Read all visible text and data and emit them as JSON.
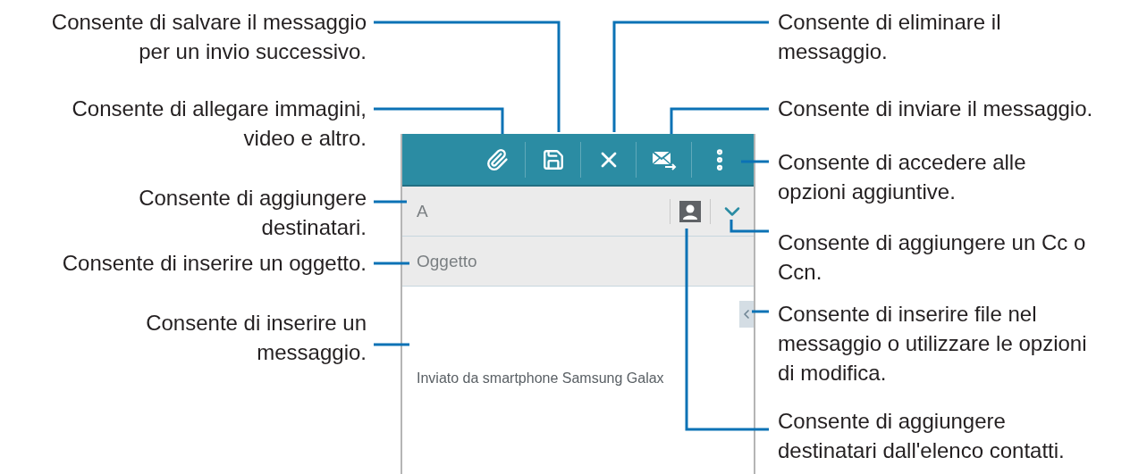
{
  "callouts_left": [
    {
      "lines": [
        "Consente di salvare il messaggio",
        "per un invio successivo."
      ]
    },
    {
      "lines": [
        "Consente di allegare immagini,",
        "video e altro."
      ]
    },
    {
      "lines": [
        "Consente di aggiungere",
        "destinatari."
      ]
    },
    {
      "lines": [
        "Consente di inserire un oggetto."
      ]
    },
    {
      "lines": [
        "Consente di inserire un",
        "messaggio."
      ]
    }
  ],
  "callouts_right": [
    {
      "lines": [
        "Consente di eliminare il",
        "messaggio."
      ]
    },
    {
      "lines": [
        "Consente di inviare il messaggio."
      ]
    },
    {
      "lines": [
        "Consente di accedere alle",
        "opzioni aggiuntive."
      ]
    },
    {
      "lines": [
        "Consente di aggiungere un Cc o",
        "Ccn."
      ]
    },
    {
      "lines": [
        "Consente di inserire file nel",
        "messaggio o utilizzare le opzioni",
        "di modifica."
      ]
    },
    {
      "lines": [
        "Consente di aggiungere",
        "destinatari dall'elenco contatti."
      ]
    }
  ],
  "phone": {
    "to_field": {
      "placeholder": "A"
    },
    "subject_field": {
      "placeholder": "Oggetto"
    },
    "body": {
      "signature": "Inviato da smartphone Samsung Galax"
    }
  }
}
